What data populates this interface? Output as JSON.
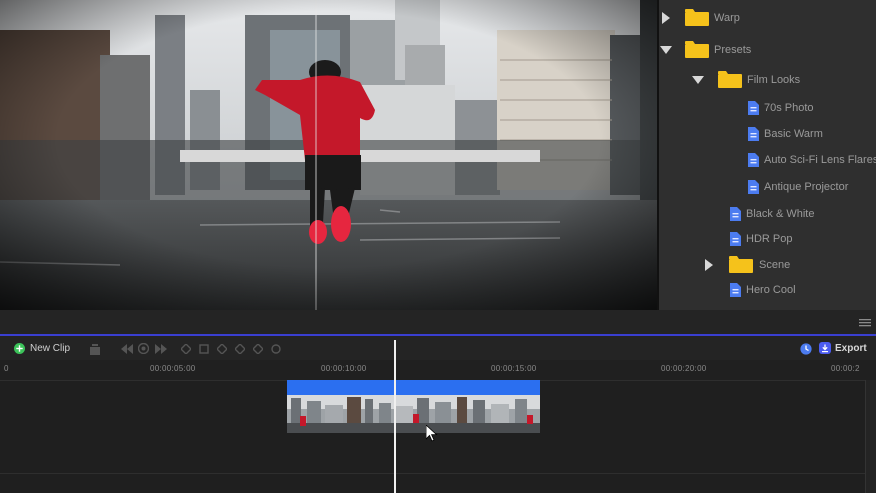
{
  "browser": {
    "items": [
      {
        "label": "Warp",
        "type": "folder",
        "state": "collapsed"
      },
      {
        "label": "Presets",
        "type": "folder",
        "state": "expanded"
      },
      {
        "label": "Film Looks",
        "type": "folder",
        "state": "expanded"
      },
      {
        "label": "70s Photo",
        "type": "preset"
      },
      {
        "label": "Basic Warm",
        "type": "preset"
      },
      {
        "label": "Auto Sci-Fi Lens Flares",
        "type": "preset"
      },
      {
        "label": "Antique Projector",
        "type": "preset"
      },
      {
        "label": "Black & White",
        "type": "preset"
      },
      {
        "label": "HDR Pop",
        "type": "preset"
      },
      {
        "label": "Scene",
        "type": "folder",
        "state": "collapsed"
      },
      {
        "label": "Hero Cool",
        "type": "preset"
      }
    ]
  },
  "toolbar": {
    "new_clip_label": "New Clip",
    "export_label": "Export"
  },
  "timeline": {
    "ruler_labels": [
      "0",
      "00:00:05:00",
      "00:00:10:00",
      "00:00:15:00",
      "00:00:20:00",
      "00:00:2"
    ],
    "playhead_time": "00:00:12:00"
  },
  "colors": {
    "accent_blue": "#3a3fd1",
    "clip_header": "#2b6ff0",
    "folder_yellow": "#f5c21b",
    "file_blue": "#4c7cf0",
    "new_clip_green": "#3cc35a"
  }
}
